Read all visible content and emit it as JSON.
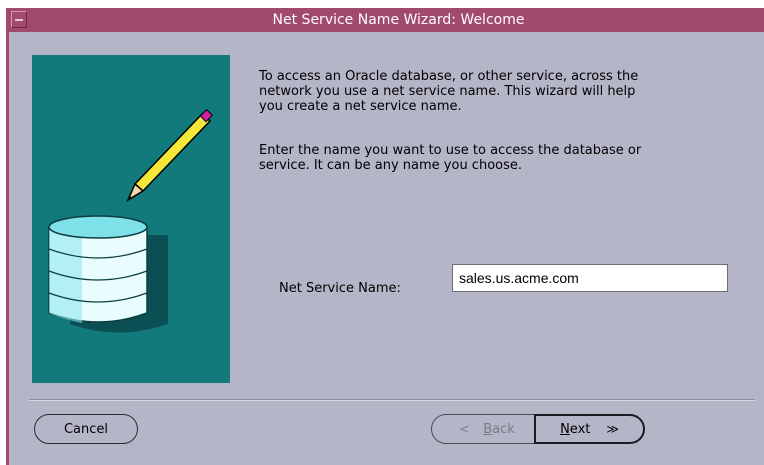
{
  "window": {
    "title": "Net Service Name Wizard: Welcome"
  },
  "intro": {
    "paragraph1": "To access an Oracle database, or other service, across the\nnetwork you use a net service name.  This wizard will help\nyou create a net service name.",
    "paragraph2": "Enter the name you want to use to access the database or\nservice.  It can be any name you choose."
  },
  "form": {
    "net_service_name_label": "Net Service Name:",
    "net_service_name_value": "sales.us.acme.com"
  },
  "buttons": {
    "cancel": "Cancel",
    "back_mnemonic": "B",
    "back_rest": "ack",
    "next_mnemonic": "N",
    "next_rest": "ext",
    "back_glyph": "<",
    "next_glyph": "≫"
  },
  "icons": {
    "illustration": "database-with-pencil-icon",
    "window_menu": "window-menu-icon"
  },
  "colors": {
    "titlebar": "#a24a6e",
    "panel": "#127a7a",
    "background": "#b5b5c8"
  }
}
